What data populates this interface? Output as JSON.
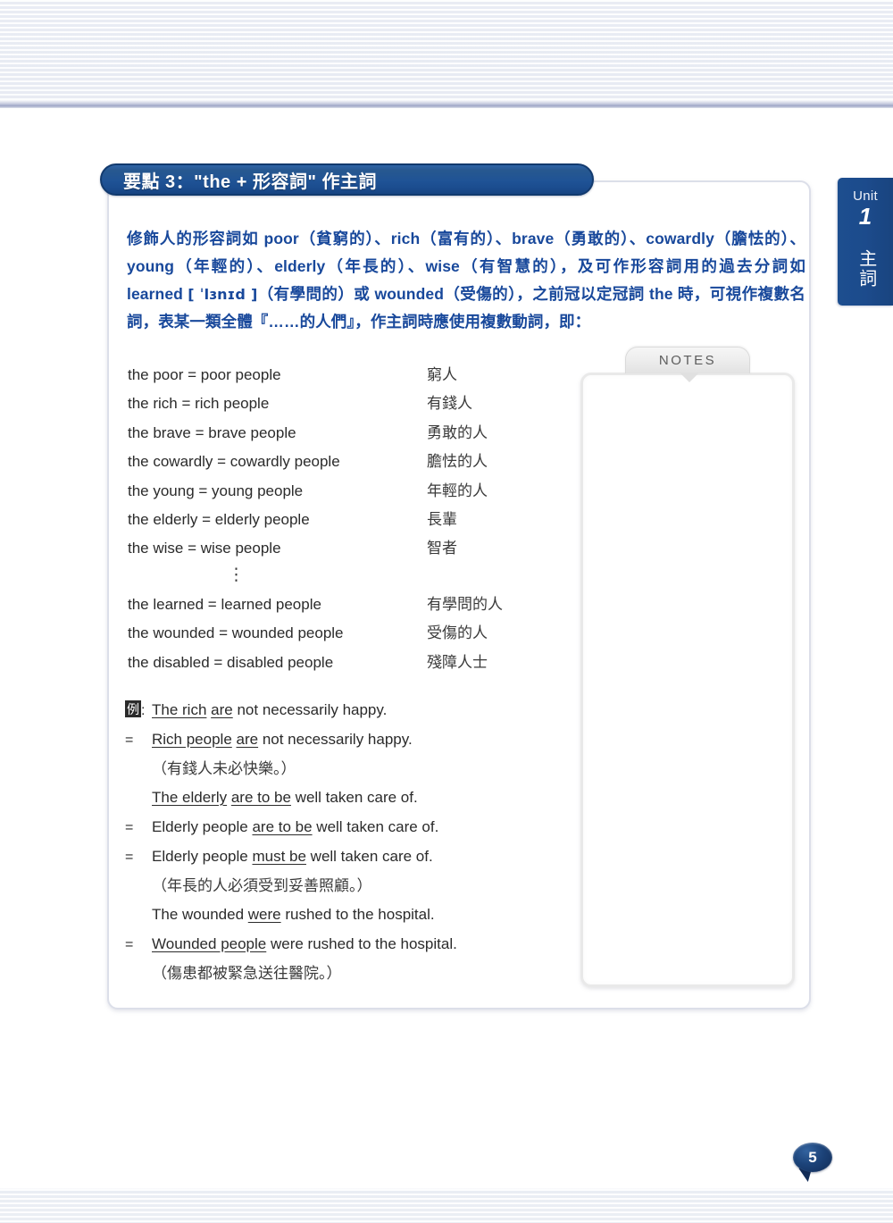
{
  "page": {
    "number": "5"
  },
  "unit_tab": {
    "unit_label": "Unit",
    "unit_number": "1",
    "unit_title_cn": "主詞",
    "accent_color": "#1c4b8c"
  },
  "banner": {
    "title": "要點 3：\"the + 形容詞\" 作主詞",
    "accent_color": "#1f5396",
    "border_color": "#123a6e"
  },
  "intro": {
    "text_color": "#18489b",
    "segment_1": "修飾人的形容詞如 ",
    "w1": "poor",
    "w1_gloss": "（貧窮的）、",
    "w2": "rich",
    "w2_gloss": "（富有的）、",
    "w3": "brave",
    "w3_gloss": "（勇敢的）、",
    "w4": "cowardly",
    "w4_gloss": "（膽怯的）、",
    "w5": "young",
    "w5_gloss": "（年輕的）、",
    "w6": "elderly",
    "w6_gloss": "（年長的）、",
    "w7": "wise",
    "w7_gloss": "（有智慧的），",
    "segment_2": "及可作形容詞用的過去分詞如 ",
    "w8": "learned",
    "w8_ipa": "[ ˈlɜnɪd ]",
    "w8_gloss": "（有學問的）或 ",
    "w9": "wounded",
    "w9_gloss": "（受傷的），",
    "segment_3": "之前冠以定冠詞 ",
    "w10": "the",
    "segment_4": " 時，可視作複數名詞，表某一類全體『……的人們』，作主詞時應使用複數動詞，即："
  },
  "vocab": {
    "ellipsis": "⋮",
    "group_1": [
      {
        "english": "the poor = poor people",
        "chinese": "窮人"
      },
      {
        "english": "the rich = rich people",
        "chinese": "有錢人"
      },
      {
        "english": "the brave = brave people",
        "chinese": "勇敢的人"
      },
      {
        "english": "the cowardly = cowardly people",
        "chinese": "膽怯的人"
      },
      {
        "english": "the young = young people",
        "chinese": "年輕的人"
      },
      {
        "english": "the elderly = elderly people",
        "chinese": "長輩"
      },
      {
        "english": "the wise = wise people",
        "chinese": "智者"
      }
    ],
    "group_2": [
      {
        "english": "the learned = learned people",
        "chinese": "有學問的人"
      },
      {
        "english": "the wounded = wounded people",
        "chinese": "受傷的人"
      },
      {
        "english": "the disabled = disabled people",
        "chinese": "殘障人士"
      }
    ]
  },
  "examples": {
    "example_marker": "例",
    "colon": ":",
    "equals": "=",
    "lines": [
      {
        "marker": "例:",
        "parts": [
          {
            "t": "The rich",
            "u": true
          },
          {
            "t": " ",
            "u": false
          },
          {
            "t": "are",
            "u": true
          },
          {
            "t": " not necessarily happy.",
            "u": false
          }
        ]
      },
      {
        "marker": "=",
        "parts": [
          {
            "t": "Rich people",
            "u": true
          },
          {
            "t": " ",
            "u": false
          },
          {
            "t": "are",
            "u": true
          },
          {
            "t": " not necessarily happy.",
            "u": false
          }
        ]
      },
      {
        "marker": "",
        "translation": "（有錢人未必快樂。）"
      },
      {
        "marker": "",
        "parts": [
          {
            "t": "The elderly",
            "u": true
          },
          {
            "t": " ",
            "u": false
          },
          {
            "t": "are to be",
            "u": true
          },
          {
            "t": " well taken care of.",
            "u": false
          }
        ]
      },
      {
        "marker": "=",
        "parts": [
          {
            "t": "Elderly people ",
            "u": false
          },
          {
            "t": "are to be",
            "u": true
          },
          {
            "t": " well taken care of.",
            "u": false
          }
        ]
      },
      {
        "marker": "=",
        "parts": [
          {
            "t": "Elderly people ",
            "u": false
          },
          {
            "t": "must be",
            "u": true
          },
          {
            "t": " well taken care of.",
            "u": false
          }
        ]
      },
      {
        "marker": "",
        "translation": "（年長的人必須受到妥善照顧。）"
      },
      {
        "marker": "",
        "parts": [
          {
            "t": "The wounded ",
            "u": false
          },
          {
            "t": "were",
            "u": true
          },
          {
            "t": " rushed to the hospital.",
            "u": false
          }
        ]
      },
      {
        "marker": "=",
        "parts": [
          {
            "t": "Wounded people",
            "u": true
          },
          {
            "t": " were rushed to the hospital.",
            "u": false
          }
        ]
      },
      {
        "marker": "",
        "translation": "（傷患都被緊急送往醫院。）"
      }
    ]
  },
  "notes": {
    "label": "NOTES",
    "content": ""
  }
}
